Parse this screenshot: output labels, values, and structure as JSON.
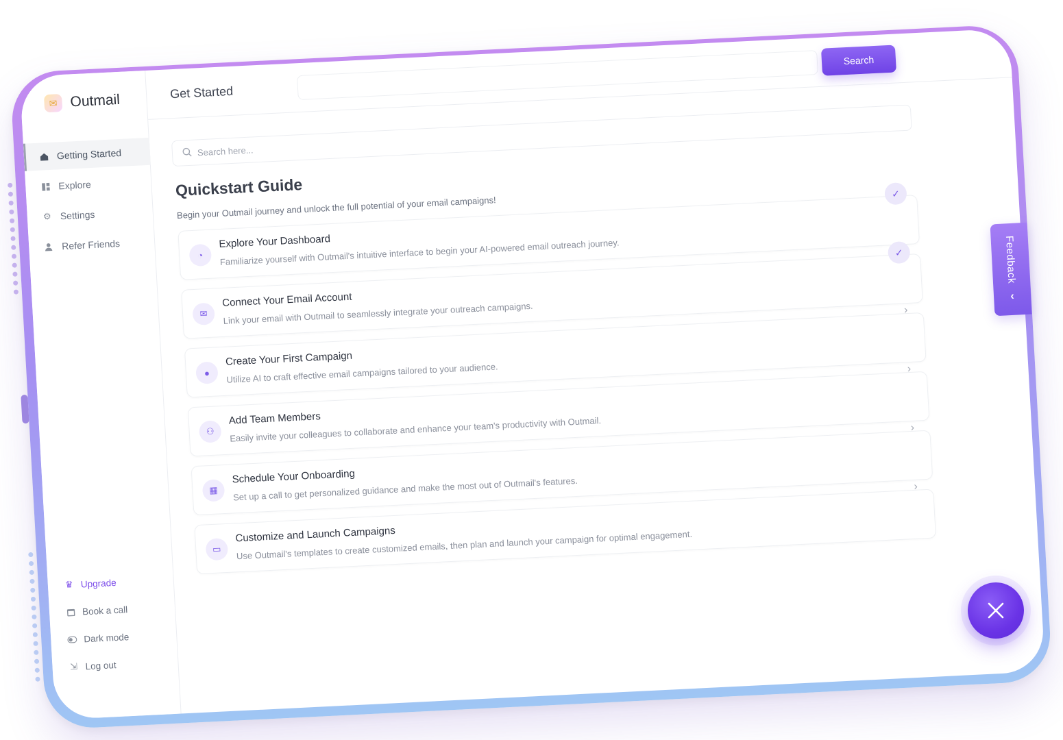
{
  "app": {
    "brand_name": "Outmail",
    "accent_color": "#7c4dea"
  },
  "sidebar": {
    "items": [
      {
        "label": "Getting Started",
        "icon": "home-icon",
        "active": true
      },
      {
        "label": "Explore",
        "icon": "grid-icon",
        "active": false
      },
      {
        "label": "Settings",
        "icon": "gear-icon",
        "active": false
      },
      {
        "label": "Refer Friends",
        "icon": "user-plus-icon",
        "active": false
      }
    ],
    "bottom": [
      {
        "label": "Upgrade",
        "icon": "crown-icon"
      },
      {
        "label": "Book a call",
        "icon": "calendar-icon"
      },
      {
        "label": "Dark mode",
        "icon": "toggle-icon"
      },
      {
        "label": "Log out",
        "icon": "logout-icon"
      }
    ]
  },
  "header": {
    "title": "Get Started",
    "search_button": "Search"
  },
  "search": {
    "placeholder": "Search here..."
  },
  "guide": {
    "title": "Quickstart Guide",
    "subtitle": "Begin your Outmail journey and unlock the full potential of your email campaigns!",
    "steps": [
      {
        "title": "Explore Your Dashboard",
        "description": "Familiarize yourself with Outmail's intuitive interface to begin your AI-powered email outreach journey.",
        "icon": "chart-pie-icon",
        "status": "completed"
      },
      {
        "title": "Connect Your Email Account",
        "description": "Link your email with Outmail to seamlessly integrate your outreach campaigns.",
        "icon": "envelope-icon",
        "status": "completed"
      },
      {
        "title": "Create Your First Campaign",
        "description": "Utilize AI to craft effective email campaigns tailored to your audience.",
        "icon": "user-icon",
        "status": "pending"
      },
      {
        "title": "Add Team Members",
        "description": "Easily invite your colleagues to collaborate and enhance your team's productivity with Outmail.",
        "icon": "team-icon",
        "status": "pending"
      },
      {
        "title": "Schedule Your Onboarding",
        "description": "Set up a call to get personalized guidance and make the most out of Outmail's features.",
        "icon": "calendar-icon",
        "status": "pending"
      },
      {
        "title": "Customize and Launch Campaigns",
        "description": "Use Outmail's templates to create customized emails, then plan and launch your campaign for optimal engagement.",
        "icon": "monitor-icon",
        "status": "pending"
      }
    ]
  },
  "feedback": {
    "label": "Feedback"
  }
}
